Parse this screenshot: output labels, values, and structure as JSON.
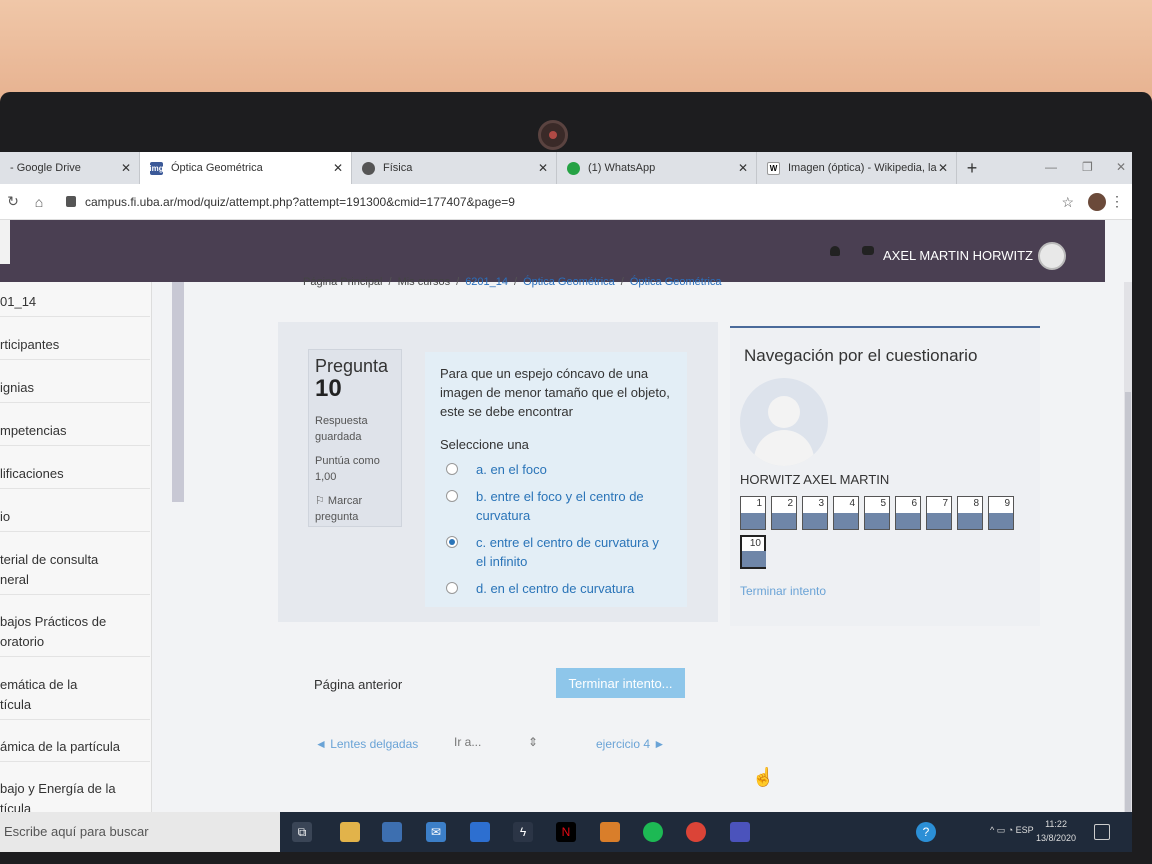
{
  "tabs": [
    {
      "title": "- Google Drive",
      "fav_color": "#2b7de9"
    },
    {
      "title": "Óptica Geométrica",
      "fav_color": "#3b5998",
      "fav_text": "img"
    },
    {
      "title": "Física",
      "fav_color": "#555555"
    },
    {
      "title": "(1) WhatsApp",
      "fav_color": "#25a244"
    },
    {
      "title": "Imagen (óptica) - Wikipedia, la",
      "fav_color": "#ffffff",
      "fav_text": "W"
    }
  ],
  "browser": {
    "url": "campus.fi.uba.ar/mod/quiz/attempt.php?attempt=191300&cmid=177407&page=9",
    "new_tab": "+"
  },
  "header": {
    "username": "AXEL MARTIN HORWITZ"
  },
  "sidebar": {
    "items": [
      {
        "label": "01_14"
      },
      {
        "label": "rticipantes"
      },
      {
        "label": "ignias"
      },
      {
        "label": "mpetencias"
      },
      {
        "label": "lificaciones"
      },
      {
        "label": "io"
      },
      {
        "label": "terial de consulta\nneral"
      },
      {
        "label": "bajos Prácticos de\noratorio"
      },
      {
        "label": "emática de la\ntícula"
      },
      {
        "label": "ámica de la partícula"
      },
      {
        "label": "bajo y Energía de la\ntícula"
      }
    ]
  },
  "breadcrumb": {
    "home": "Página Principal",
    "courses": "Mis cursos",
    "course": "6201_14",
    "section": "Óptica Geométrica",
    "activity": "Óptica Geométrica"
  },
  "question": {
    "label": "Pregunta",
    "number": "10",
    "status": "Respuesta guardada",
    "grade": "Puntúa como 1,00",
    "flag": "Marcar pregunta",
    "text": "Para que un espejo cóncavo de una imagen de menor tamaño que el objeto, este se debe encontrar",
    "choose": "Seleccione una",
    "options": [
      {
        "text": "a. en el foco",
        "selected": false
      },
      {
        "text": "b. entre el foco y el centro de curvatura",
        "selected": false
      },
      {
        "text": "c. entre el centro de curvatura y el infinito",
        "selected": true
      },
      {
        "text": "d. en el centro de curvatura",
        "selected": false
      }
    ]
  },
  "page_nav": {
    "previous": "Página anterior",
    "finish": "Terminar intento...",
    "prev_activity": "◄ Lentes delgadas",
    "jump_placeholder": "Ir a...",
    "next_activity": "ejercicio 4 ►"
  },
  "quiz_nav": {
    "title": "Navegación por el cuestionario",
    "user": "HORWITZ AXEL MARTIN",
    "questions": [
      "1",
      "2",
      "3",
      "4",
      "5",
      "6",
      "7",
      "8",
      "9",
      "10"
    ],
    "current": "10",
    "finish_link": "Terminar intento"
  },
  "taskbar": {
    "search": "Escribe aquí para buscar",
    "lang": "ESP",
    "time": "11:22",
    "date": "13/8/2020"
  }
}
